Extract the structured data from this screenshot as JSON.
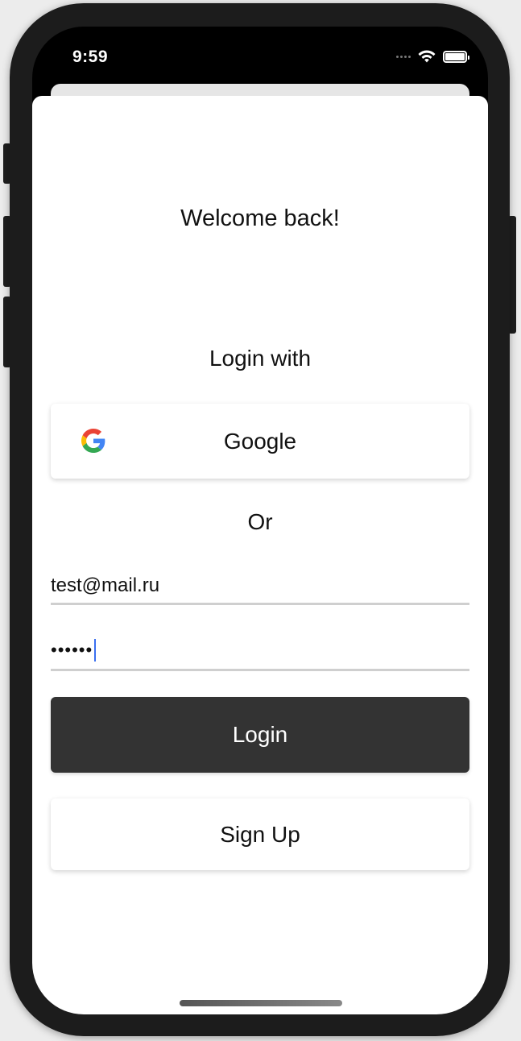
{
  "status_bar": {
    "time": "9:59"
  },
  "screen": {
    "welcome_title": "Welcome back!",
    "login_with_label": "Login with",
    "google_button_label": "Google",
    "or_label": "Or",
    "email": {
      "value": "test@mail.ru"
    },
    "password": {
      "masked_value": "••••••"
    },
    "login_button_label": "Login",
    "signup_button_label": "Sign Up"
  },
  "colors": {
    "login_button_bg": "#333333",
    "caret": "#3a6ff0",
    "google_blue": "#4285F4",
    "google_red": "#EA4335",
    "google_yellow": "#FBBC05",
    "google_green": "#34A853"
  },
  "icons": [
    "wifi-icon",
    "battery-icon",
    "signal-icon",
    "google-icon"
  ]
}
